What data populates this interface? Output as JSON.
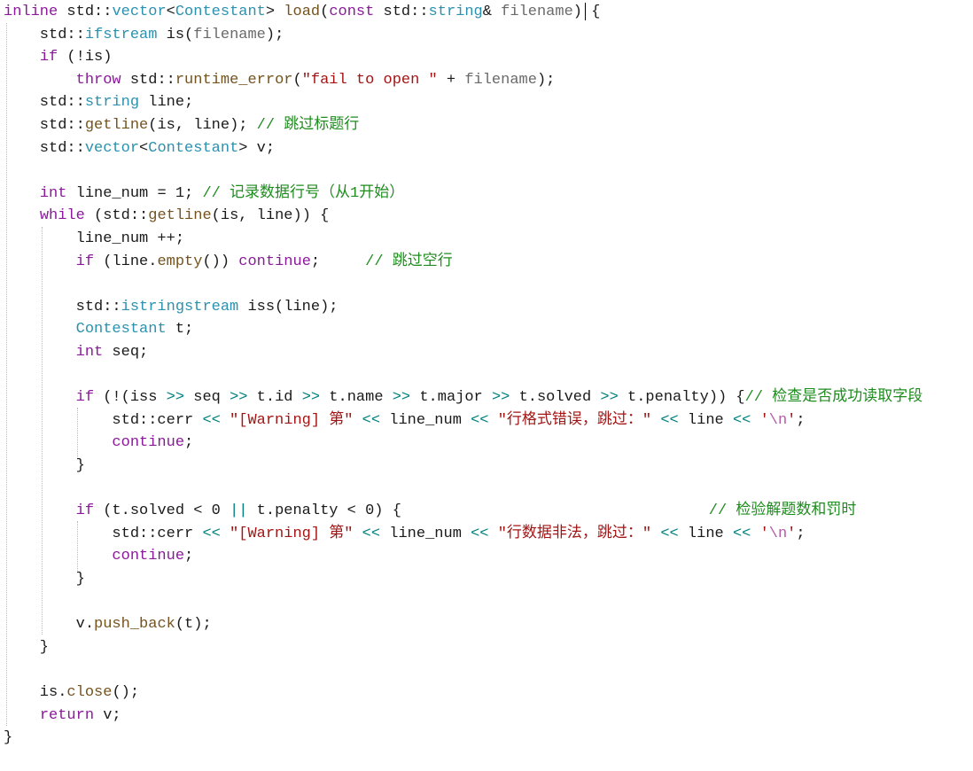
{
  "code_lines": [
    [
      {
        "t": "inline",
        "k": "kw"
      },
      {
        "t": " std::",
        "k": "ns"
      },
      {
        "t": "vector",
        "k": "ty"
      },
      {
        "t": "<",
        "k": "id"
      },
      {
        "t": "Contestant",
        "k": "ty"
      },
      {
        "t": "> ",
        "k": "id"
      },
      {
        "t": "load",
        "k": "fn"
      },
      {
        "t": "(",
        "k": "id"
      },
      {
        "t": "const",
        "k": "kw"
      },
      {
        "t": " std::",
        "k": "ns"
      },
      {
        "t": "string",
        "k": "ty"
      },
      {
        "t": "& ",
        "k": "id"
      },
      {
        "t": "filename",
        "k": "pl"
      },
      {
        "t": ") {",
        "k": "id"
      }
    ],
    [
      {
        "t": "    std::",
        "k": "ns"
      },
      {
        "t": "ifstream",
        "k": "ty"
      },
      {
        "t": " is(",
        "k": "id"
      },
      {
        "t": "filename",
        "k": "pl"
      },
      {
        "t": ");",
        "k": "id"
      }
    ],
    [
      {
        "t": "    ",
        "k": "id"
      },
      {
        "t": "if",
        "k": "kw"
      },
      {
        "t": " (!is)",
        "k": "id"
      }
    ],
    [
      {
        "t": "        ",
        "k": "id"
      },
      {
        "t": "throw",
        "k": "kw"
      },
      {
        "t": " std::",
        "k": "ns"
      },
      {
        "t": "runtime_error",
        "k": "fn"
      },
      {
        "t": "(",
        "k": "id"
      },
      {
        "t": "\"fail to open \"",
        "k": "str"
      },
      {
        "t": " + ",
        "k": "id"
      },
      {
        "t": "filename",
        "k": "pl"
      },
      {
        "t": ");",
        "k": "id"
      }
    ],
    [
      {
        "t": "    std::",
        "k": "ns"
      },
      {
        "t": "string",
        "k": "ty"
      },
      {
        "t": " line;",
        "k": "id"
      }
    ],
    [
      {
        "t": "    std::",
        "k": "ns"
      },
      {
        "t": "getline",
        "k": "fn"
      },
      {
        "t": "(is, line); ",
        "k": "id"
      },
      {
        "t": "// 跳过标题行",
        "k": "cm"
      }
    ],
    [
      {
        "t": "    std::",
        "k": "ns"
      },
      {
        "t": "vector",
        "k": "ty"
      },
      {
        "t": "<",
        "k": "id"
      },
      {
        "t": "Contestant",
        "k": "ty"
      },
      {
        "t": "> v;",
        "k": "id"
      }
    ],
    [],
    [
      {
        "t": "    ",
        "k": "id"
      },
      {
        "t": "int",
        "k": "kw"
      },
      {
        "t": " line_num = 1; ",
        "k": "id"
      },
      {
        "t": "// 记录数据行号（从1开始）",
        "k": "cm"
      }
    ],
    [
      {
        "t": "    ",
        "k": "id"
      },
      {
        "t": "while",
        "k": "kw"
      },
      {
        "t": " (std::",
        "k": "ns"
      },
      {
        "t": "getline",
        "k": "fn"
      },
      {
        "t": "(is, line)) {",
        "k": "id"
      }
    ],
    [
      {
        "t": "        line_num ++;",
        "k": "id"
      }
    ],
    [
      {
        "t": "        ",
        "k": "id"
      },
      {
        "t": "if",
        "k": "kw"
      },
      {
        "t": " (line.",
        "k": "id"
      },
      {
        "t": "empty",
        "k": "fn"
      },
      {
        "t": "()) ",
        "k": "id"
      },
      {
        "t": "continue",
        "k": "kw"
      },
      {
        "t": ";     ",
        "k": "id"
      },
      {
        "t": "// 跳过空行",
        "k": "cm"
      }
    ],
    [],
    [
      {
        "t": "        std::",
        "k": "ns"
      },
      {
        "t": "istringstream",
        "k": "ty"
      },
      {
        "t": " iss(line);",
        "k": "id"
      }
    ],
    [
      {
        "t": "        ",
        "k": "id"
      },
      {
        "t": "Contestant",
        "k": "ty"
      },
      {
        "t": " t;",
        "k": "id"
      }
    ],
    [
      {
        "t": "        ",
        "k": "id"
      },
      {
        "t": "int",
        "k": "kw"
      },
      {
        "t": " seq;",
        "k": "id"
      }
    ],
    [],
    [
      {
        "t": "        ",
        "k": "id"
      },
      {
        "t": "if",
        "k": "kw"
      },
      {
        "t": " (!(iss ",
        "k": "id"
      },
      {
        "t": ">>",
        "k": "op"
      },
      {
        "t": " seq ",
        "k": "id"
      },
      {
        "t": ">>",
        "k": "op"
      },
      {
        "t": " t.id ",
        "k": "id"
      },
      {
        "t": ">>",
        "k": "op"
      },
      {
        "t": " t.name ",
        "k": "id"
      },
      {
        "t": ">>",
        "k": "op"
      },
      {
        "t": " t.major ",
        "k": "id"
      },
      {
        "t": ">>",
        "k": "op"
      },
      {
        "t": " t.solved ",
        "k": "id"
      },
      {
        "t": ">>",
        "k": "op"
      },
      {
        "t": " t.penalty)) {",
        "k": "id"
      },
      {
        "t": "// 检查是否成功读取字段",
        "k": "cm"
      }
    ],
    [
      {
        "t": "            std::cerr ",
        "k": "ns"
      },
      {
        "t": "<<",
        "k": "op"
      },
      {
        "t": " ",
        "k": "id"
      },
      {
        "t": "\"[Warning] 第\"",
        "k": "str"
      },
      {
        "t": " ",
        "k": "id"
      },
      {
        "t": "<<",
        "k": "op"
      },
      {
        "t": " line_num ",
        "k": "id"
      },
      {
        "t": "<<",
        "k": "op"
      },
      {
        "t": " ",
        "k": "id"
      },
      {
        "t": "\"行格式错误，跳过：\"",
        "k": "str"
      },
      {
        "t": " ",
        "k": "id"
      },
      {
        "t": "<<",
        "k": "op"
      },
      {
        "t": " line ",
        "k": "id"
      },
      {
        "t": "<<",
        "k": "op"
      },
      {
        "t": " ",
        "k": "id"
      },
      {
        "t": "'",
        "k": "str"
      },
      {
        "t": "\\n",
        "k": "esc"
      },
      {
        "t": "'",
        "k": "str"
      },
      {
        "t": ";",
        "k": "id"
      }
    ],
    [
      {
        "t": "            ",
        "k": "id"
      },
      {
        "t": "continue",
        "k": "kw"
      },
      {
        "t": ";",
        "k": "id"
      }
    ],
    [
      {
        "t": "        }",
        "k": "id"
      }
    ],
    [],
    [
      {
        "t": "        ",
        "k": "id"
      },
      {
        "t": "if",
        "k": "kw"
      },
      {
        "t": " (t.solved < 0 ",
        "k": "id"
      },
      {
        "t": "||",
        "k": "op"
      },
      {
        "t": " t.penalty < 0) {                                  ",
        "k": "id"
      },
      {
        "t": "// 检验解题数和罚时",
        "k": "cm"
      }
    ],
    [
      {
        "t": "            std::cerr ",
        "k": "ns"
      },
      {
        "t": "<<",
        "k": "op"
      },
      {
        "t": " ",
        "k": "id"
      },
      {
        "t": "\"[Warning] 第\"",
        "k": "str"
      },
      {
        "t": " ",
        "k": "id"
      },
      {
        "t": "<<",
        "k": "op"
      },
      {
        "t": " line_num ",
        "k": "id"
      },
      {
        "t": "<<",
        "k": "op"
      },
      {
        "t": " ",
        "k": "id"
      },
      {
        "t": "\"行数据非法，跳过：\"",
        "k": "str"
      },
      {
        "t": " ",
        "k": "id"
      },
      {
        "t": "<<",
        "k": "op"
      },
      {
        "t": " line ",
        "k": "id"
      },
      {
        "t": "<<",
        "k": "op"
      },
      {
        "t": " ",
        "k": "id"
      },
      {
        "t": "'",
        "k": "str"
      },
      {
        "t": "\\n",
        "k": "esc"
      },
      {
        "t": "'",
        "k": "str"
      },
      {
        "t": ";",
        "k": "id"
      }
    ],
    [
      {
        "t": "            ",
        "k": "id"
      },
      {
        "t": "continue",
        "k": "kw"
      },
      {
        "t": ";",
        "k": "id"
      }
    ],
    [
      {
        "t": "        }",
        "k": "id"
      }
    ],
    [],
    [
      {
        "t": "        v.",
        "k": "id"
      },
      {
        "t": "push_back",
        "k": "fn"
      },
      {
        "t": "(t);",
        "k": "id"
      }
    ],
    [
      {
        "t": "    }",
        "k": "id"
      }
    ],
    [],
    [
      {
        "t": "    is.",
        "k": "id"
      },
      {
        "t": "close",
        "k": "fn"
      },
      {
        "t": "();",
        "k": "id"
      }
    ],
    [
      {
        "t": "    ",
        "k": "id"
      },
      {
        "t": "return",
        "k": "kw"
      },
      {
        "t": " v;",
        "k": "id"
      }
    ],
    [
      {
        "t": "}",
        "k": "id"
      }
    ]
  ],
  "colors": {
    "keyword": "#8a1a9a",
    "type": "#2b91af",
    "function": "#74531f",
    "string": "#a31515",
    "comment": "#1f8c1f",
    "parameter": "#6a6a6a",
    "operator": "#008080"
  }
}
